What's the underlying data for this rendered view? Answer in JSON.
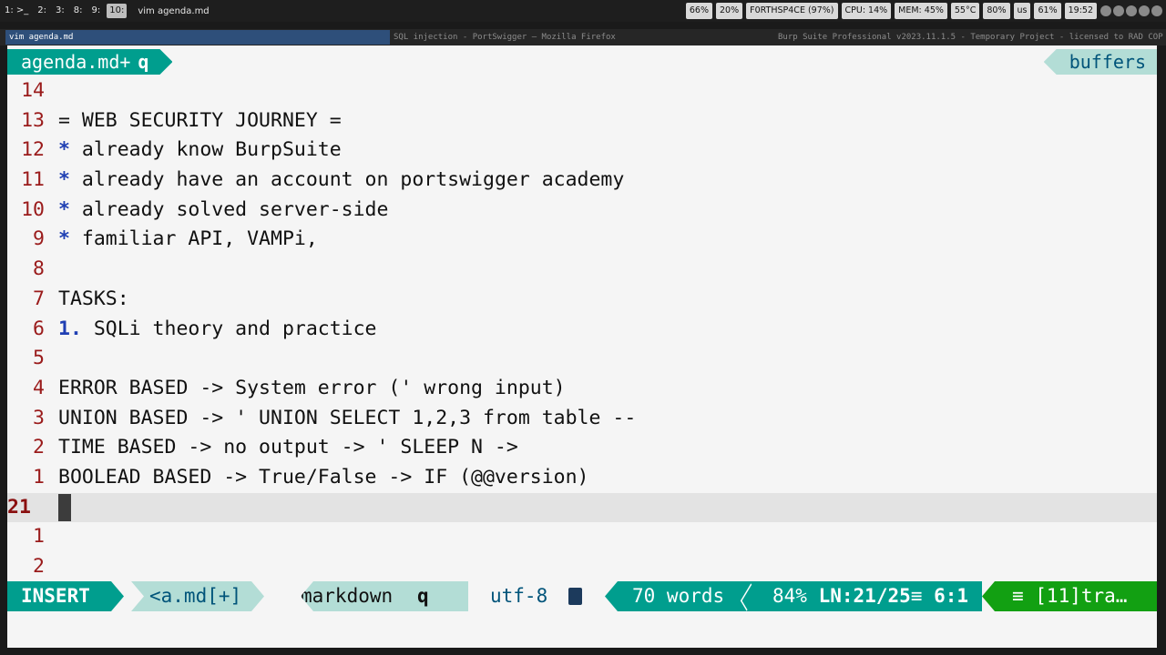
{
  "topbar": {
    "workspaces": [
      "1: >_",
      "2: ",
      "3: ",
      "8: ",
      "9: ",
      "10: "
    ],
    "active_workspace_index": 5,
    "window_title": "vim agenda.md",
    "status": {
      "volume": "66%",
      "brightness": "20%",
      "wifi": "F0RTHSP4CE (97%)",
      "cpu": "CPU: 14%",
      "mem": "MEM: 45%",
      "temp": "55°C",
      "battery": "80%",
      "layout": "us",
      "disk": "61%",
      "time": "19:52"
    }
  },
  "titlebar": {
    "tabs": [
      "vim agenda.md",
      "SQL injection - PortSwigger — Mozilla Firefox",
      "Burp Suite Professional v2023.11.1.5 - Temporary Project - licensed to RAD COP"
    ]
  },
  "tabline": {
    "current": "agenda.md+",
    "current_suffix": "q",
    "right": "buffers"
  },
  "lines": [
    {
      "n": "14",
      "text": ""
    },
    {
      "n": "13",
      "text": "= WEB SECURITY JOURNEY ="
    },
    {
      "n": "12",
      "bullet": "*",
      "text": " already know BurpSuite"
    },
    {
      "n": "11",
      "bullet": "*",
      "text": " already have an account on portswigger academy"
    },
    {
      "n": "10",
      "bullet": "*",
      "text": " already solved server-side"
    },
    {
      "n": "9",
      "bullet": "*",
      "text": " familiar API, VAMPi,"
    },
    {
      "n": "8",
      "text": ""
    },
    {
      "n": "7",
      "text": "TASKS:"
    },
    {
      "n": "6",
      "bullet": "1.",
      "text": " SQLi theory and practice"
    },
    {
      "n": "5",
      "text": ""
    },
    {
      "n": "4",
      "text": "ERROR BASED -> System error (' wrong input)"
    },
    {
      "n": "3",
      "text": "UNION BASED -> ' UNION SELECT 1,2,3 from table --"
    },
    {
      "n": "2",
      "text": "TIME BASED -> no output -> ' SLEEP N ->"
    },
    {
      "n": "1",
      "text": "BOOLEAD BASED -> True/False -> IF (@@version)"
    },
    {
      "n": "21",
      "text": "",
      "current": true
    },
    {
      "n": "1",
      "text": ""
    },
    {
      "n": "2",
      "text": ""
    }
  ],
  "statusline": {
    "mode": "INSERT",
    "filename": "<a.md[+]",
    "filetype": "markdown",
    "filetype_suffix": "q",
    "encoding": "utf-8",
    "words": "70 words",
    "percent": "84%",
    "ln_label": "LN",
    "line_col": ":21/25",
    "colsep": "≡",
    "col": "6:1",
    "terminal": "≡ [11]tra…"
  }
}
